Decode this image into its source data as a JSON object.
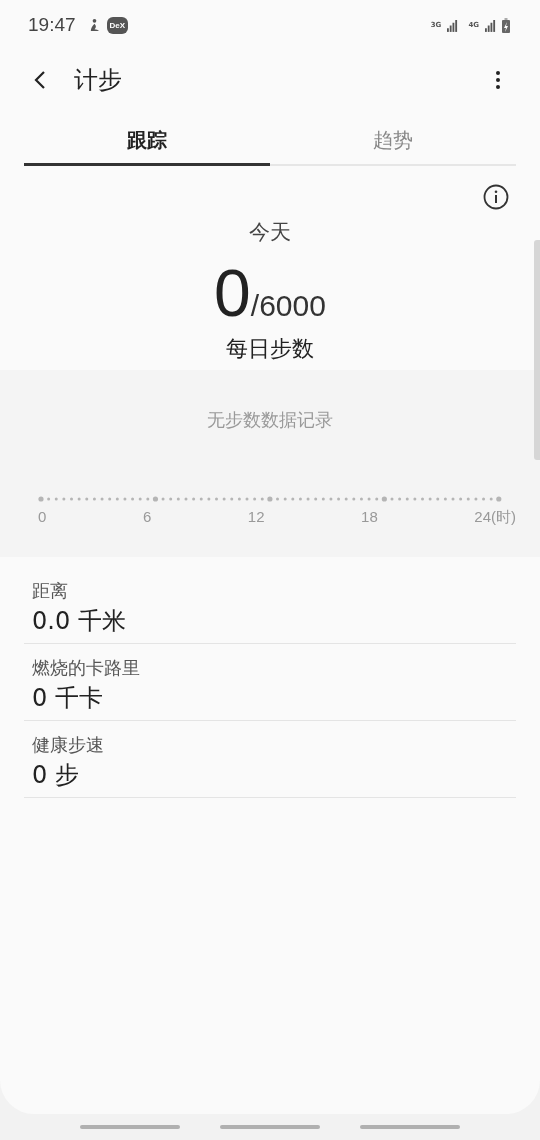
{
  "status_bar": {
    "time": "19:47",
    "dex_badge": "DeX",
    "network_1": "3G",
    "network_2": "4G"
  },
  "header": {
    "title": "计步"
  },
  "tabs": [
    {
      "label": "跟踪",
      "selected": true
    },
    {
      "label": "趋势",
      "selected": false
    }
  ],
  "summary": {
    "day": "今天",
    "steps": "0",
    "goal": "/6000",
    "caption": "每日步数"
  },
  "chart": {
    "empty_message": "无步数数据记录",
    "axis_labels": [
      "0",
      "6",
      "12",
      "18",
      "24(时)"
    ]
  },
  "stats": [
    {
      "label": "距离",
      "value": "0.0 千米"
    },
    {
      "label": "燃烧的卡路里",
      "value": "0 千卡"
    },
    {
      "label": "健康步速",
      "value": "0 步"
    }
  ]
}
